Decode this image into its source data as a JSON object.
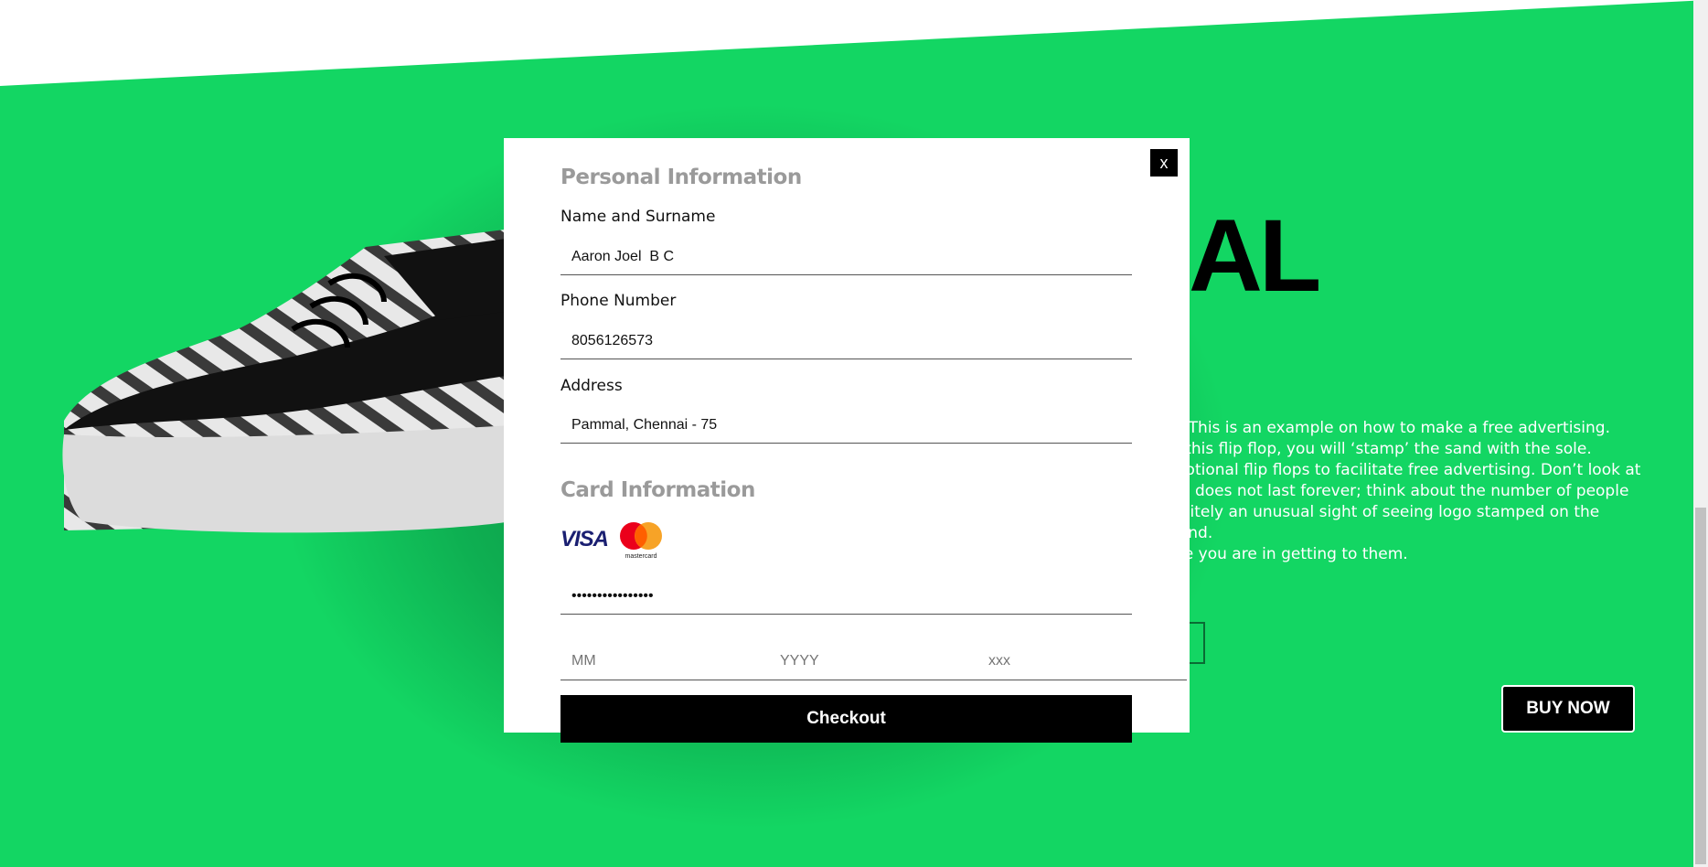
{
  "hero": {
    "title": "AL",
    "description": "s. This is an example on how to make a free advertising.\nh this flip flop, you will ‘stamp’ the sand with the sole.\nmotional flip flops to facilitate free advertising. Don’t look at\nnd does not last forever; think about the number of people\nfinitely an unusual sight of seeing logo stamped on the sand.\nive you are in getting to them.",
    "buy_now_label": "BUY NOW"
  },
  "modal": {
    "close_label": "x",
    "personal_title": "Personal Information",
    "fields": {
      "name_label": "Name and Surname",
      "name_value": "Aaron Joel  B C",
      "phone_label": "Phone Number",
      "phone_value": "8056126573",
      "address_label": "Address",
      "address_value": "Pammal, Chennai - 75"
    },
    "card_title": "Card Information",
    "card": {
      "visa_label": "VISA",
      "mastercard_label": "mastercard",
      "number_masked": "••••••••••••••••",
      "month_placeholder": "MM",
      "year_placeholder": "YYYY",
      "cvv_placeholder": "xxx"
    },
    "checkout_label": "Checkout"
  }
}
